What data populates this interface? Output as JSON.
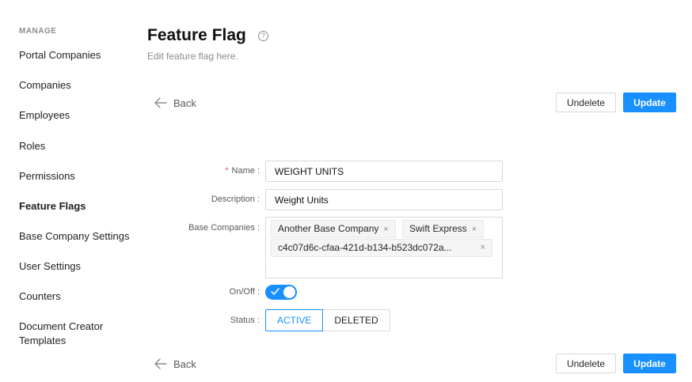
{
  "sidebar": {
    "heading": "MANAGE",
    "items": [
      {
        "label": "Portal Companies"
      },
      {
        "label": "Companies"
      },
      {
        "label": "Employees"
      },
      {
        "label": "Roles"
      },
      {
        "label": "Permissions"
      },
      {
        "label": "Feature Flags",
        "active": true
      },
      {
        "label": "Base Company Settings"
      },
      {
        "label": "User Settings"
      },
      {
        "label": "Counters"
      },
      {
        "label": "Document Creator"
      },
      {
        "label": "Templates"
      }
    ]
  },
  "header": {
    "title": "Feature Flag",
    "help_icon": "?",
    "subtitle": "Edit feature flag here."
  },
  "actions": {
    "back_label": "Back",
    "undelete_label": "Undelete",
    "update_label": "Update"
  },
  "form": {
    "name_label": "Name",
    "name_value": "WEIGHT UNITS",
    "description_label": "Description",
    "description_value": "Weight Units",
    "base_companies_label": "Base Companies",
    "base_companies": [
      "Another Base Company",
      "Swift Express",
      "c4c07d6c-cfaa-421d-b134-b523dc072a..."
    ],
    "tag_remove_glyph": "×",
    "onoff_label": "On/Off",
    "onoff_value": true,
    "status_label": "Status",
    "status_options": [
      "ACTIVE",
      "DELETED"
    ],
    "status_selected": "ACTIVE",
    "label_suffix": ":"
  },
  "colors": {
    "primary": "#1890ff",
    "required": "#ff4d4f"
  }
}
